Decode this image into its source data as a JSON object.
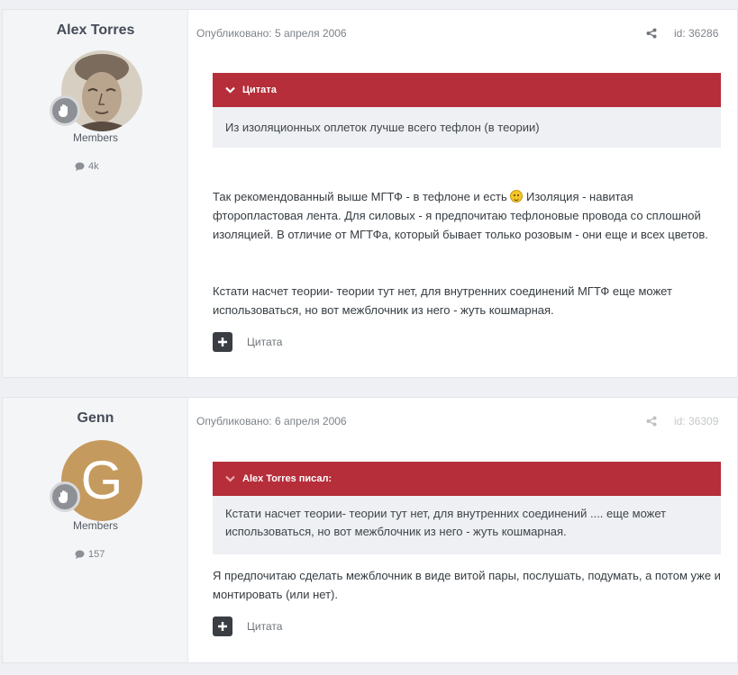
{
  "posts": [
    {
      "author": "Alex Torres",
      "group": "Members",
      "post_count": "4k",
      "published": "Опубликовано: 5 апреля 2006",
      "post_id": "id: 36286",
      "quote_title": "Цитата",
      "quote_text": "Из изоляционных оплеток лучше всего тефлон (в теории)",
      "paragraph1_part1": "Так рекомендованный выше МГТФ - в тефлоне и есть",
      "paragraph1_part2": " Изоляция - навитая фторопластовая лента. Для силовых - я предпочитаю тефлоновые провода со сплошной изоляцией. В отличие от МГТФа, который бывает только розовым - они еще и всех цветов.",
      "paragraph2": "Кстати насчет теории- теории тут нет, для внутренних соединений МГТФ еще может использоваться, но вот межблочник из него - жуть кошмарная.",
      "quote_action": "Цитата"
    },
    {
      "author": "Genn",
      "avatar_letter": "G",
      "avatar_color": "#c59a5e",
      "group": "Members",
      "post_count": "157",
      "published": "Опубликовано: 6 апреля 2006",
      "post_id": "id: 36309",
      "quote_title": "Alex Torres писал:",
      "quote_text": "Кстати насчет теории- теории тут нет, для внутренних соединений .... еще может использоваться, но вот межблочник из него - жуть кошмарная.",
      "paragraph1": "Я предпочитаю сделать межблочник в виде витой пары, послушать, подумать, а потом уже и монтировать (или нет).",
      "quote_action": "Цитата"
    }
  ],
  "colors": {
    "quote_header": "#b52e3a",
    "quote_body": "#eef0f3",
    "author_panel": "#f4f5f7",
    "button_dark": "#3a3e43"
  },
  "icons": [
    "chevron-down-icon",
    "share-icon",
    "comment-icon",
    "rank-hand-icon",
    "plus-icon",
    "smiley-icon"
  ]
}
